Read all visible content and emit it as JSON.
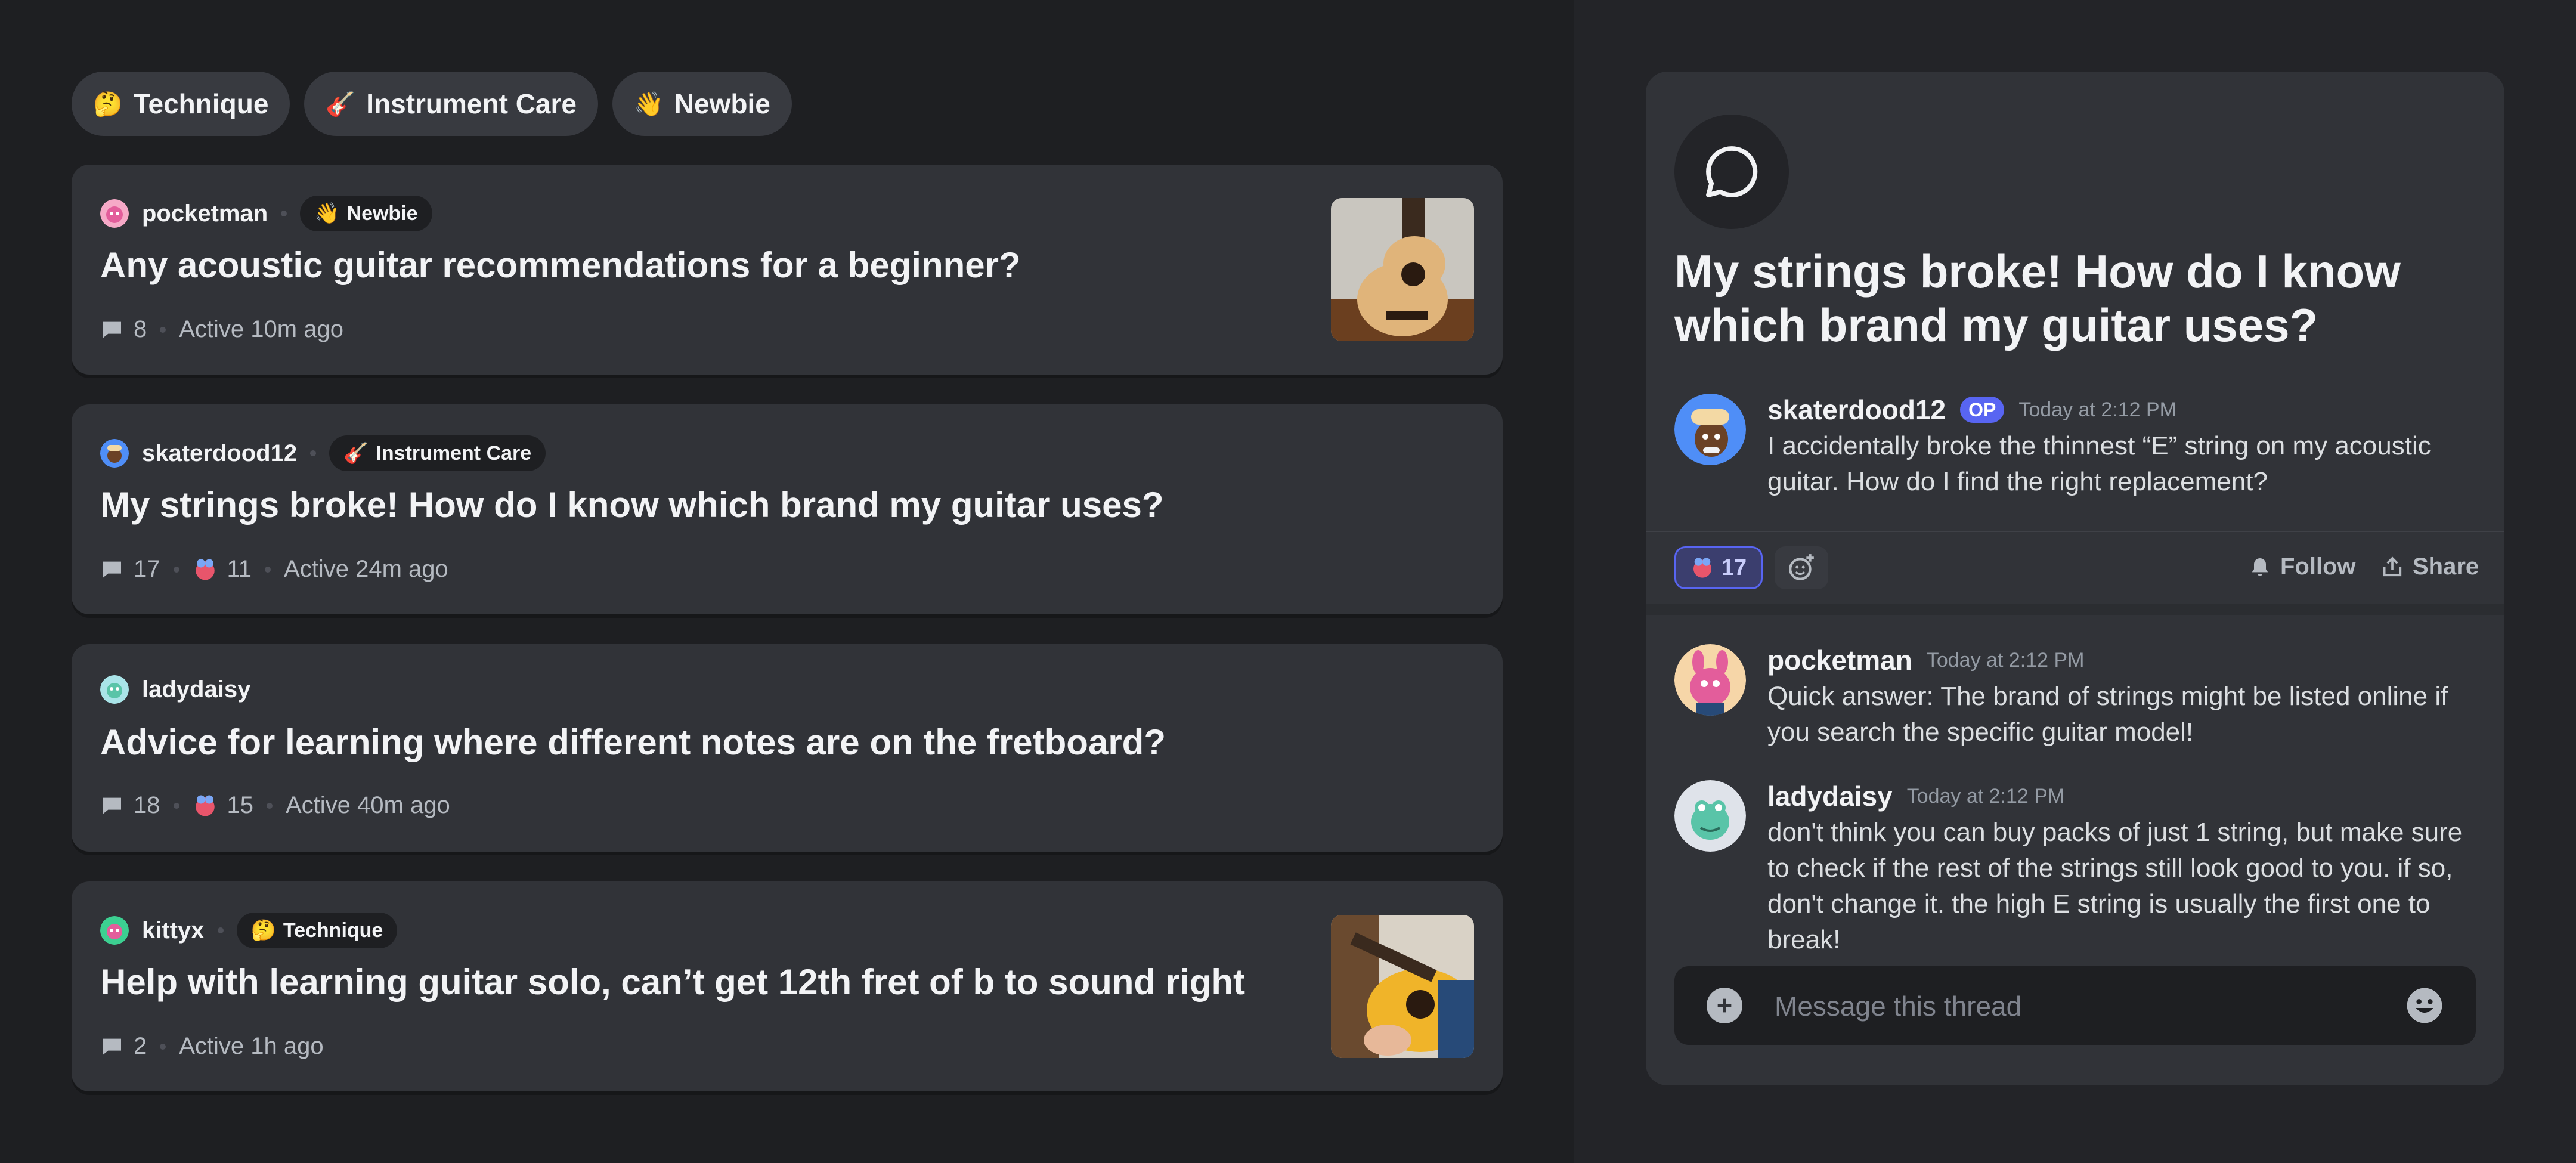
{
  "filter_tags": [
    {
      "emoji": "🤔",
      "label": "Technique"
    },
    {
      "emoji": "🎸",
      "label": "Instrument Care"
    },
    {
      "emoji": "👋",
      "label": "Newbie"
    }
  ],
  "posts": [
    {
      "username": "pocketman",
      "tag": {
        "emoji": "👋",
        "label": "Newbie"
      },
      "title": "Any acoustic guitar recommendations for a beginner?",
      "comments": "8",
      "reactions": "",
      "active": "Active 10m ago"
    },
    {
      "username": "skaterdood12",
      "tag": {
        "emoji": "🎸",
        "label": "Instrument Care"
      },
      "title": "My strings broke! How do I know which brand my guitar uses?",
      "comments": "17",
      "reactions": "11",
      "active": "Active 24m ago"
    },
    {
      "username": "ladydaisy",
      "tag": null,
      "title": "Advice for learning where different notes are on the fretboard?",
      "comments": "18",
      "reactions": "15",
      "active": "Active 40m ago"
    },
    {
      "username": "kittyx",
      "tag": {
        "emoji": "🤔",
        "label": "Technique"
      },
      "title": "Help with learning guitar solo, can’t get 12th fret of b to sound right",
      "comments": "2",
      "reactions": "",
      "active": "Active 1h ago"
    }
  ],
  "thread": {
    "title": "My strings broke! How do I know which brand my guitar uses?",
    "op": {
      "author": "skaterdood12",
      "badge": "OP",
      "time": "Today at 2:12 PM",
      "text": "I accidentally broke the thinnest “E” string on my acoustic guitar. How do I find the right replacement?"
    },
    "reaction_count": "17",
    "follow_label": "Follow",
    "share_label": "Share",
    "replies": [
      {
        "author": "pocketman",
        "time": "Today at 2:12 PM",
        "text": "Quick answer: The brand of strings might be listed online if you search the specific guitar model!"
      },
      {
        "author": "ladydaisy",
        "time": "Today at 2:12 PM",
        "text": "don't think you can buy packs of just 1 string, but make sure to check if the rest of the strings still look good to you. if so, don't change it. the high E string is usually the first one to break!"
      }
    ],
    "composer_placeholder": "Message this thread"
  }
}
